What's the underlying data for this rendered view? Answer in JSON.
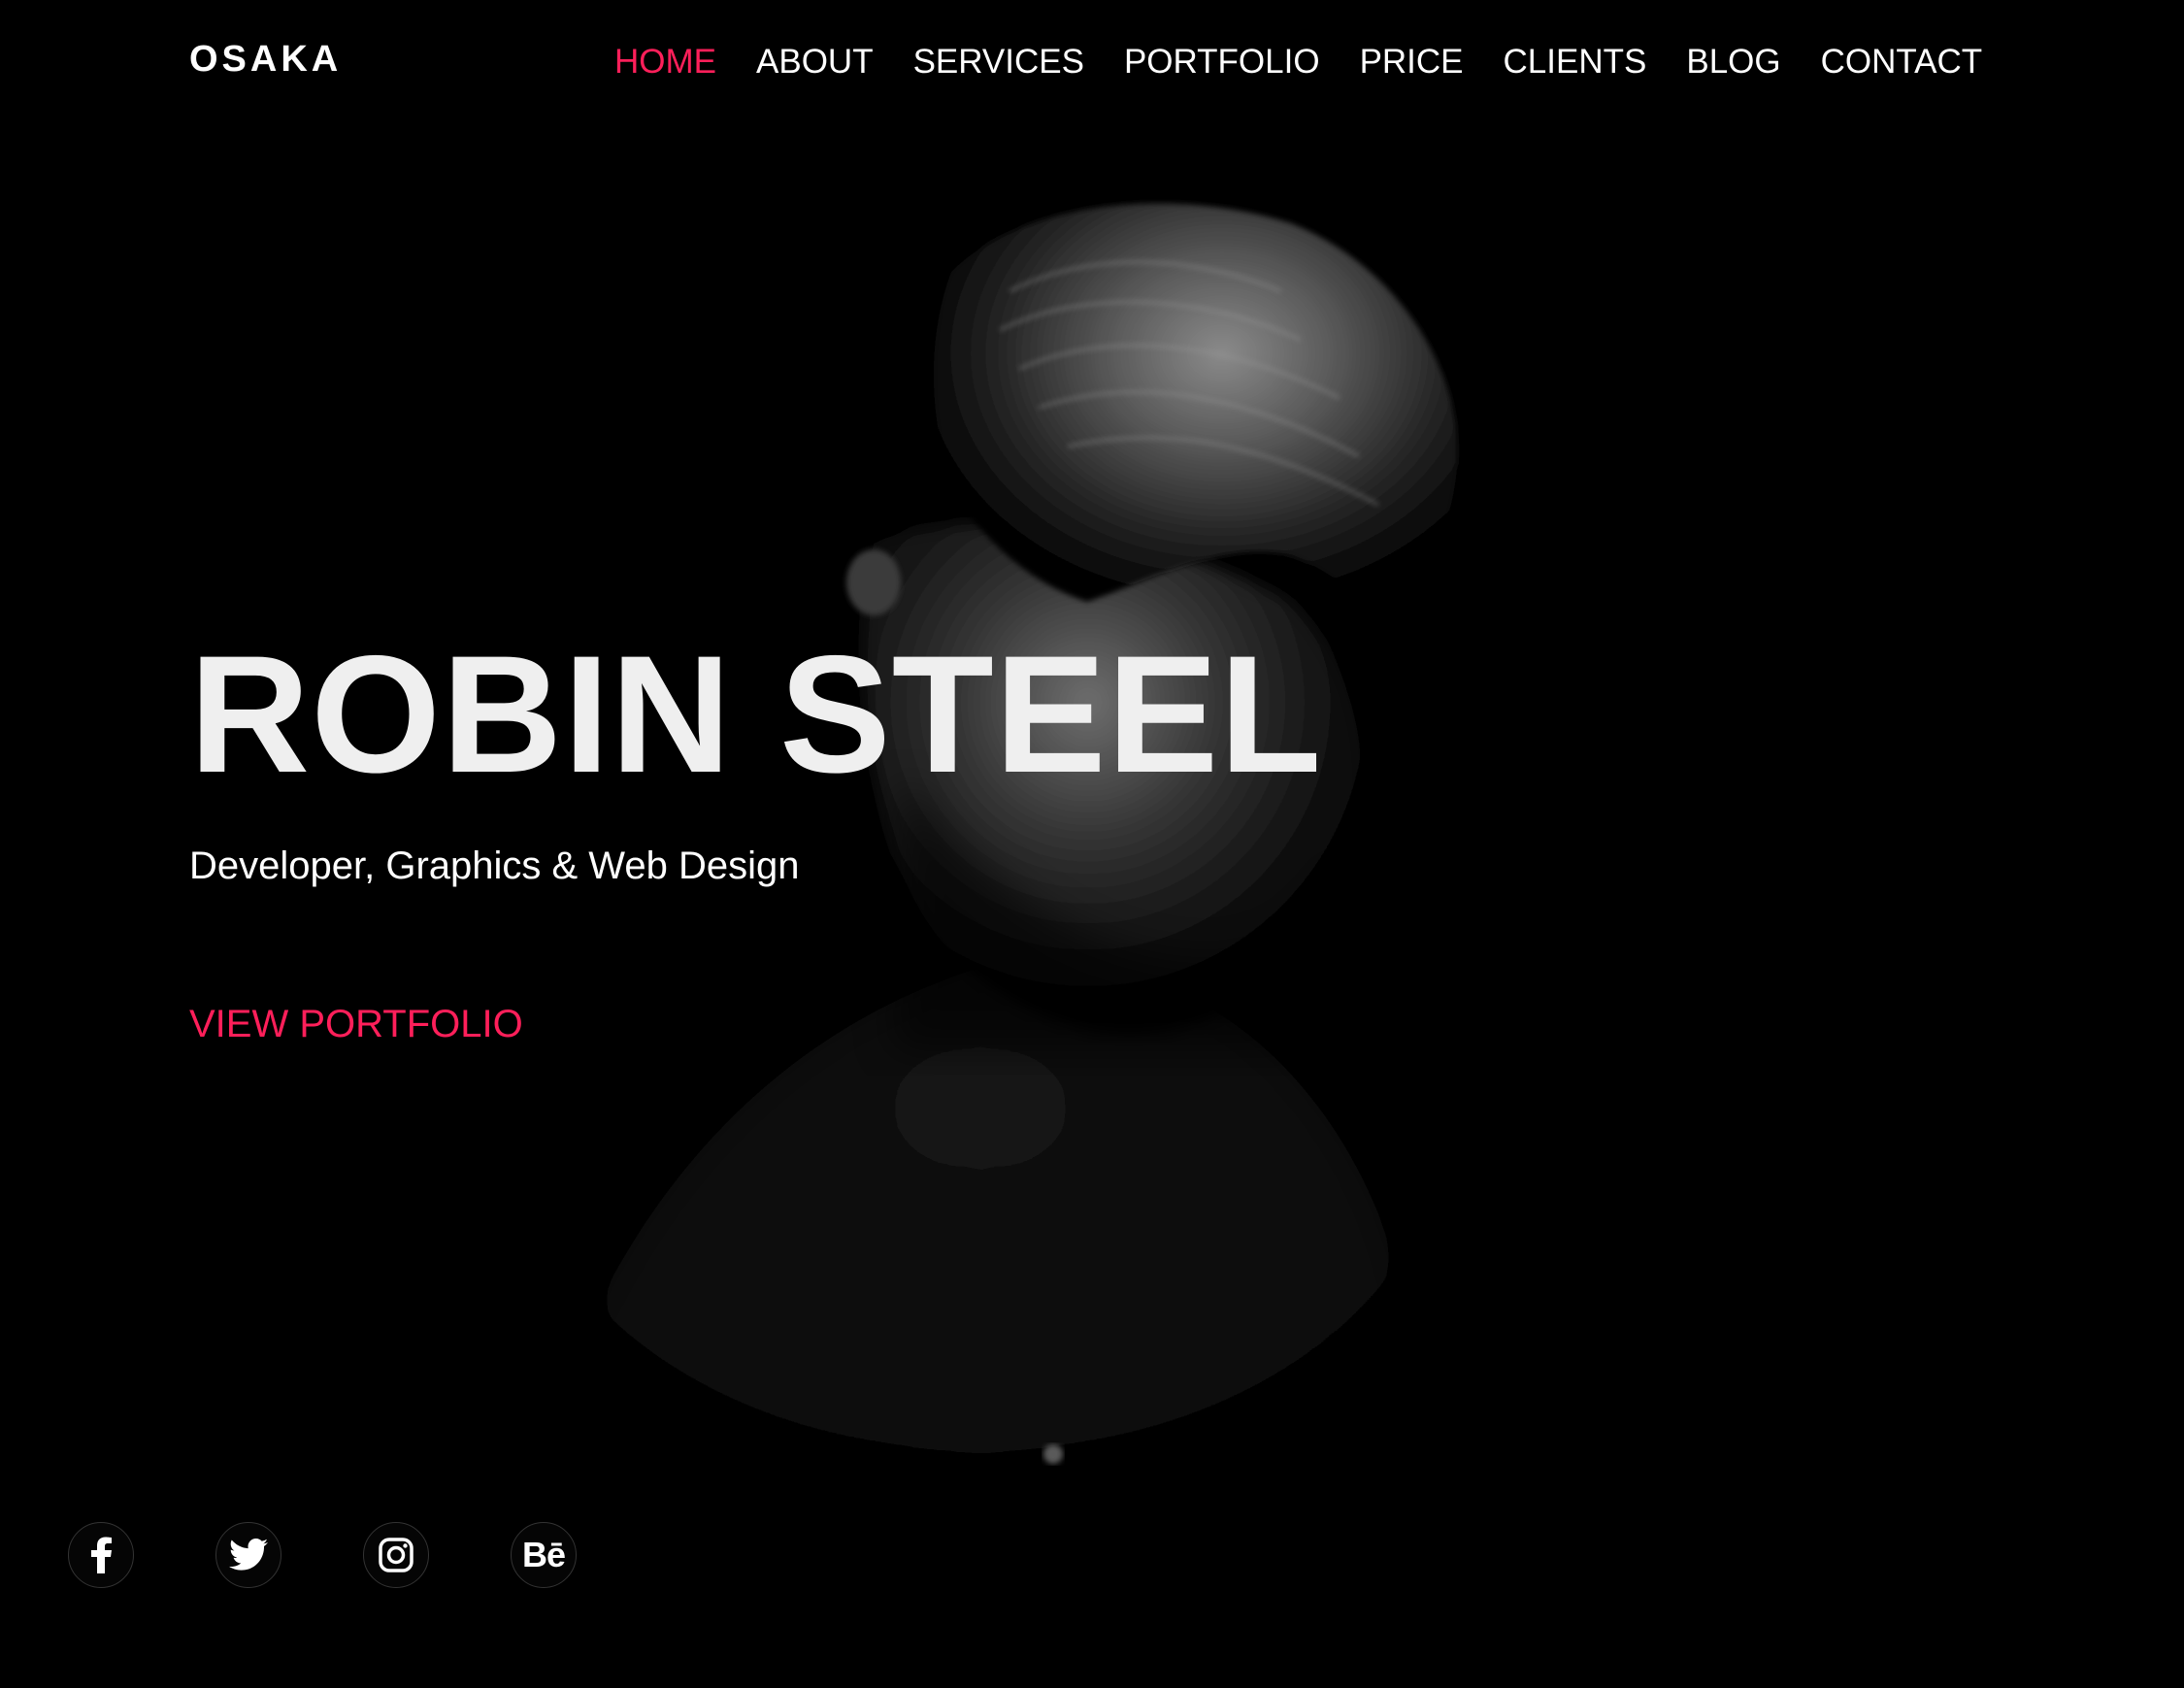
{
  "site": {
    "logo": "OSAKA"
  },
  "nav": {
    "items": [
      {
        "label": "HOME",
        "active": true
      },
      {
        "label": "ABOUT",
        "active": false
      },
      {
        "label": "SERVICES",
        "active": false
      },
      {
        "label": "PORTFOLIO",
        "active": false
      },
      {
        "label": "PRICE",
        "active": false
      },
      {
        "label": "CLIENTS",
        "active": false
      },
      {
        "label": "BLOG",
        "active": false
      },
      {
        "label": "CONTACT",
        "active": false
      }
    ]
  },
  "hero": {
    "title": "ROBIN STEEL",
    "subtitle": "Developer, Graphics & Web Design",
    "cta": "VIEW PORTFOLIO"
  },
  "socials": {
    "items": [
      {
        "icon": "facebook-icon"
      },
      {
        "icon": "twitter-icon"
      },
      {
        "icon": "instagram-icon"
      },
      {
        "icon": "behance-icon",
        "label": "Bē"
      }
    ]
  },
  "colors": {
    "background": "#000000",
    "accent": "#ff1f5a",
    "text": "#ffffff",
    "title": "#efefef"
  }
}
